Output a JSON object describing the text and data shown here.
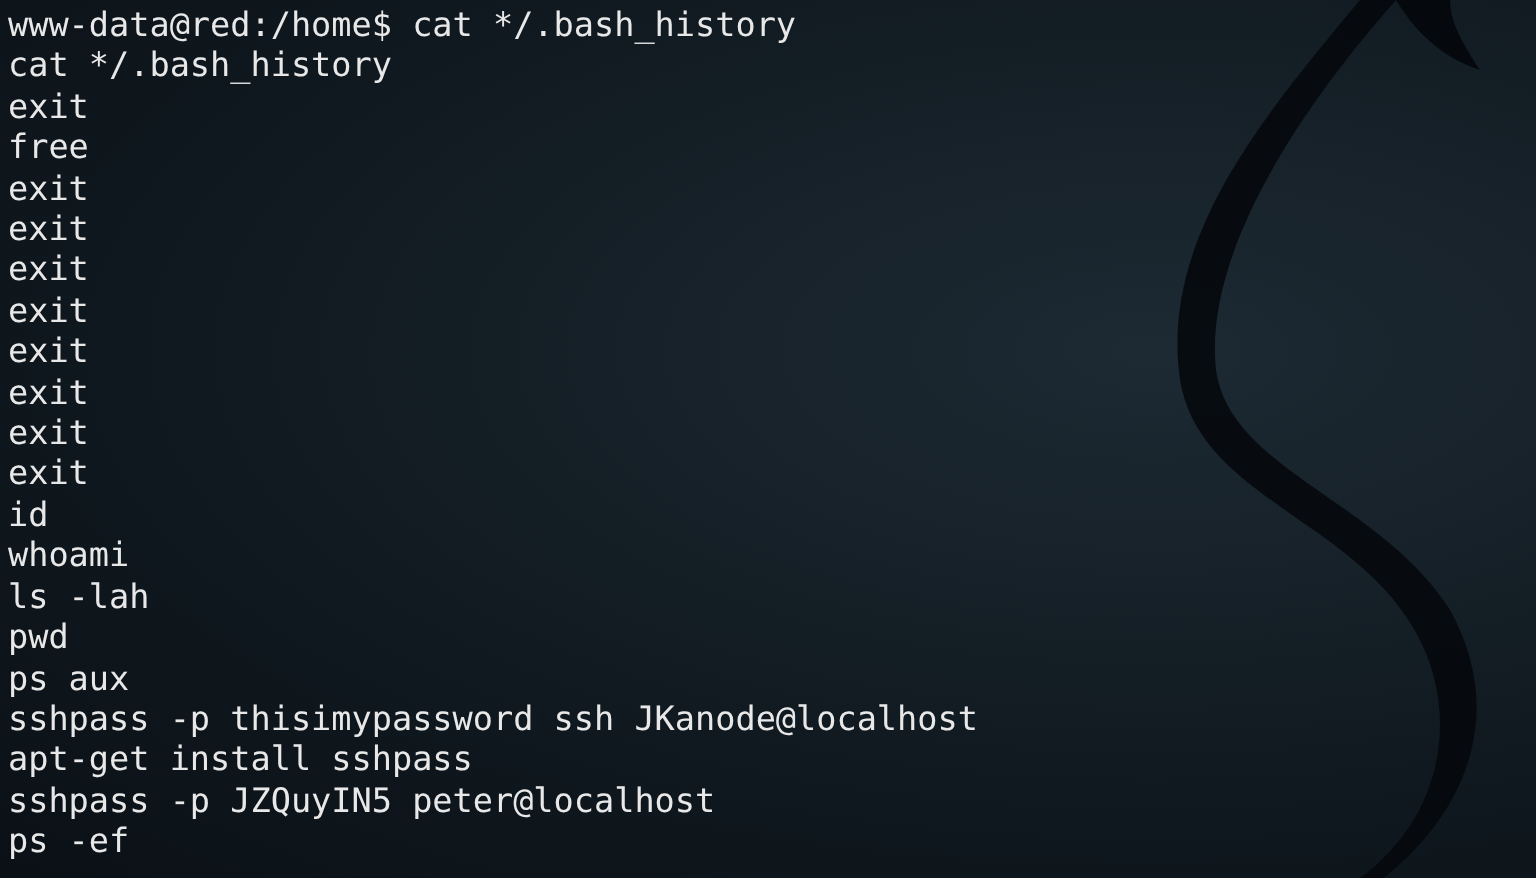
{
  "terminal": {
    "lines": [
      "www-data@red:/home$ cat */.bash_history",
      "cat */.bash_history",
      "exit",
      "free",
      "exit",
      "exit",
      "exit",
      "exit",
      "exit",
      "exit",
      "exit",
      "exit",
      "id",
      "whoami",
      "ls -lah",
      "pwd",
      "ps aux",
      "sshpass -p thisimypassword ssh JKanode@localhost",
      "apt-get install sshpass",
      "sshpass -p JZQuyIN5 peter@localhost",
      "ps -ef"
    ]
  }
}
